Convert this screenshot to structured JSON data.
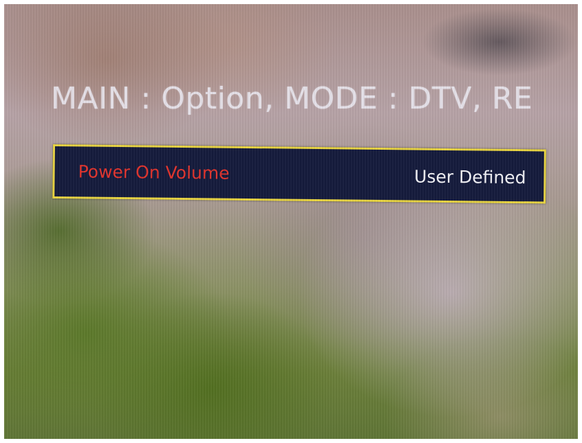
{
  "header": {
    "breadcrumb": "MAIN : Option, MODE : DTV, RE"
  },
  "menu": {
    "selected_item": {
      "label": "Power On Volume",
      "value": "User Defined"
    }
  },
  "colors": {
    "label_text": "#e0332c",
    "value_text": "#f0f0f4",
    "highlight_border": "#e8d441",
    "row_background": "#151b3c",
    "breadcrumb_text": "#e9e6ee"
  }
}
